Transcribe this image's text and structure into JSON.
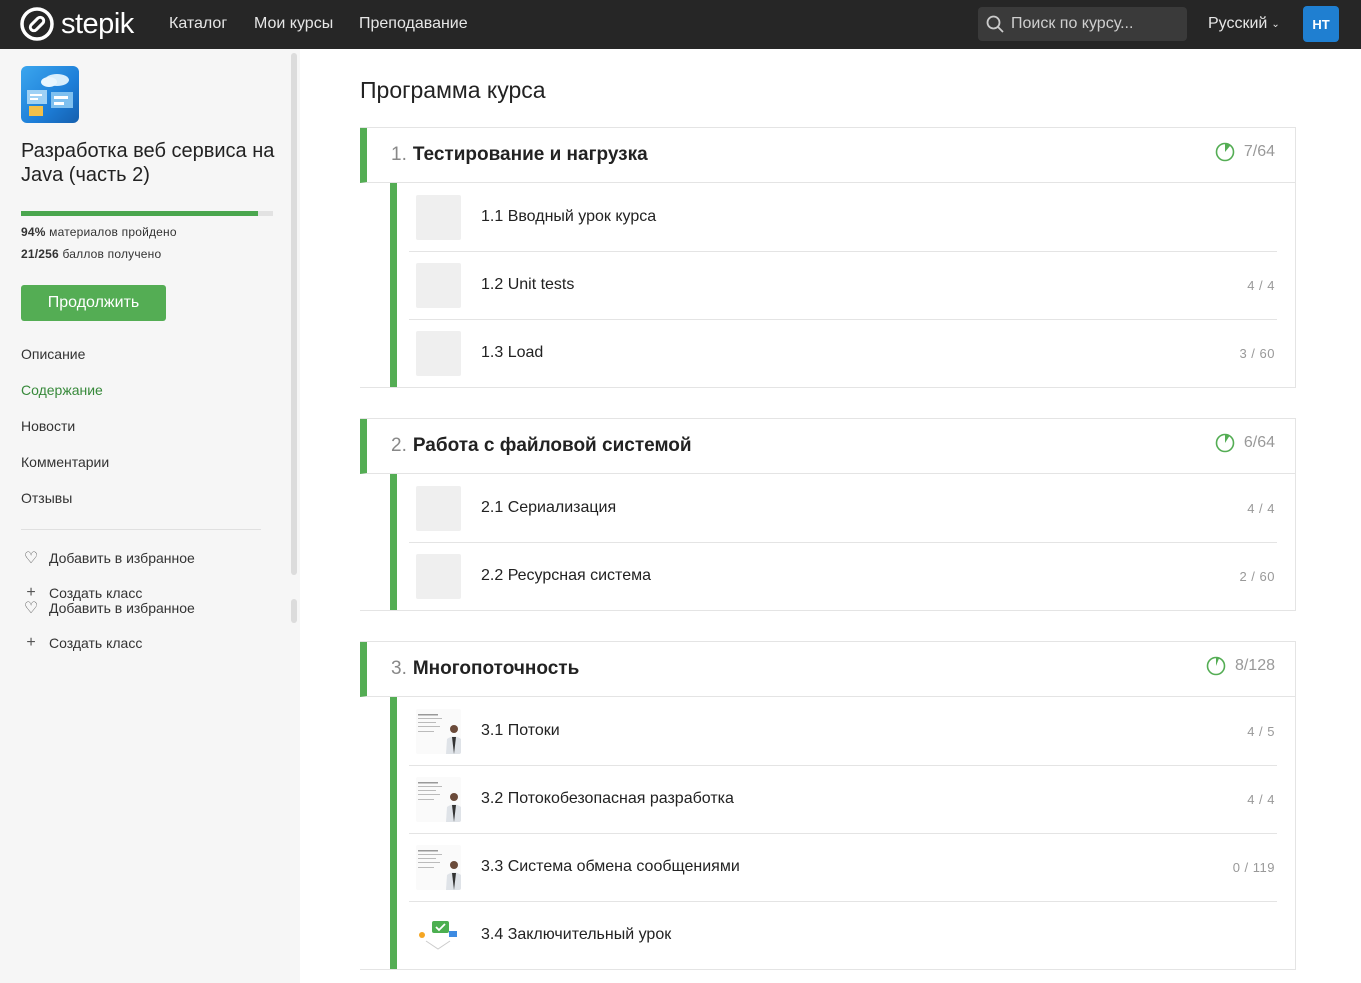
{
  "header": {
    "logo_text": "stepik",
    "nav": [
      "Каталог",
      "Мои курсы",
      "Преподавание"
    ],
    "search_placeholder": "Поиск по курсу...",
    "language": "Русский",
    "avatar_initials": "HT"
  },
  "sidebar": {
    "course_title": "Разработка веб сервиса на Java (часть 2)",
    "progress_percent": 94,
    "progress_pct_label": "94%",
    "progress_text": " материалов пройдено",
    "points_label": "21/256",
    "points_text": " баллов получено",
    "continue_label": "Продолжить",
    "links": [
      "Описание",
      "Содержание",
      "Новости",
      "Комментарии",
      "Отзывы"
    ],
    "active_link": "Содержание",
    "actions": [
      {
        "icon": "heart-icon",
        "label": "Добавить в избранное"
      },
      {
        "icon": "plus-icon",
        "label": "Создать класс"
      },
      {
        "icon": "heart-icon",
        "label": "Добавить в избранное"
      },
      {
        "icon": "plus-icon",
        "label": "Создать класс"
      }
    ]
  },
  "main": {
    "title": "Программа курса",
    "sections": [
      {
        "num": "1.",
        "title": "Тестирование и нагрузка",
        "progress": "7/64",
        "progress_fraction": 0.11,
        "lessons": [
          {
            "title": "1.1 Вводный урок курса",
            "score": "",
            "thumb": "blank"
          },
          {
            "title": "1.2 Unit tests",
            "score": "4 / 4",
            "thumb": "blank"
          },
          {
            "title": "1.3 Load",
            "score": "3 / 60",
            "thumb": "blank"
          }
        ]
      },
      {
        "num": "2.",
        "title": "Работа с файловой системой",
        "progress": "6/64",
        "progress_fraction": 0.09,
        "lessons": [
          {
            "title": "2.1 Сериализация",
            "score": "4 / 4",
            "thumb": "blank"
          },
          {
            "title": "2.2 Ресурсная система",
            "score": "2 / 60",
            "thumb": "blank"
          }
        ]
      },
      {
        "num": "3.",
        "title": "Многопоточность",
        "progress": "8/128",
        "progress_fraction": 0.06,
        "lessons": [
          {
            "title": "3.1 Потоки",
            "score": "4 / 5",
            "thumb": "video"
          },
          {
            "title": "3.2 Потокобезопасная разработка",
            "score": "4 / 4",
            "thumb": "video"
          },
          {
            "title": "3.3 Система обмена сообщениями",
            "score": "0 / 119",
            "thumb": "video"
          },
          {
            "title": "3.4 Заключительный урок",
            "score": "",
            "thumb": "illustration"
          }
        ]
      }
    ]
  },
  "colors": {
    "header_bg": "#262626",
    "accent_green": "#54ad54",
    "avatar_blue": "#1f7fd1",
    "sidebar_bg": "#f6f6f6"
  }
}
